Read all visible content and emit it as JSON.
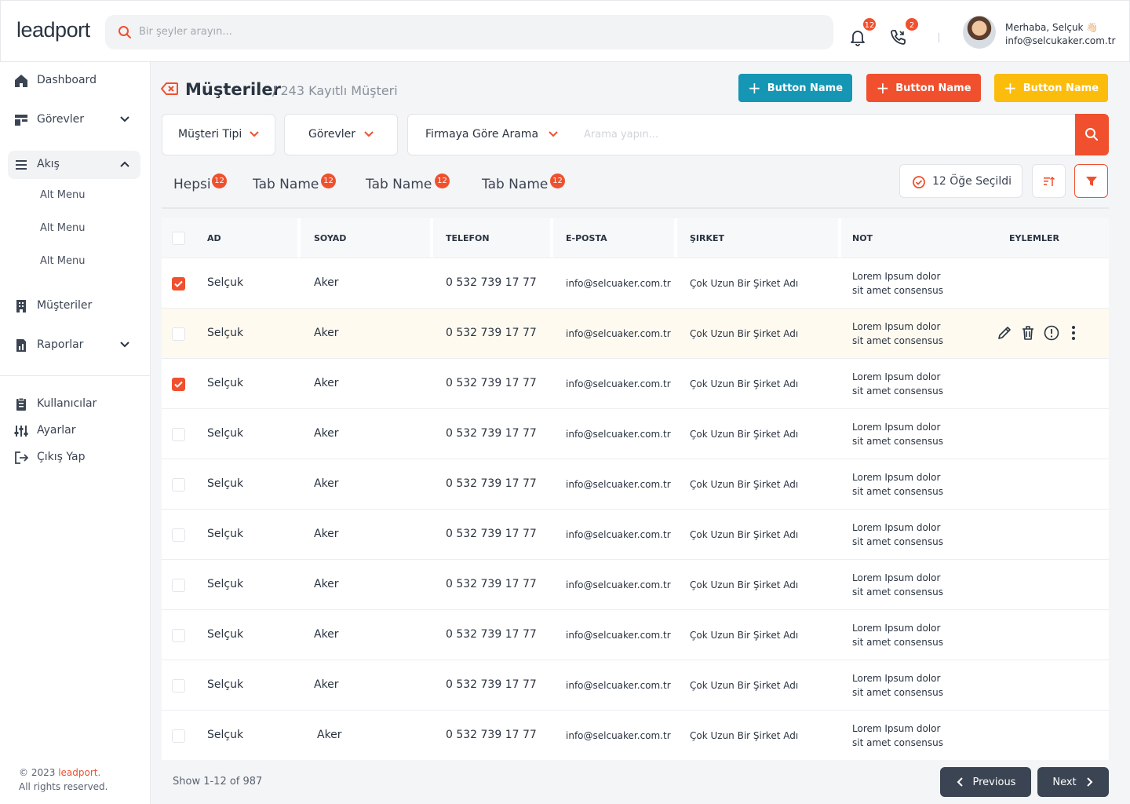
{
  "brand": {
    "logo": "leadport"
  },
  "search": {
    "placeholder": "Bir şeyler arayın..."
  },
  "notifications": {
    "bell_count": "12",
    "call_count": "2"
  },
  "user": {
    "greeting": "Merhaba, Selçuk 👋🏻",
    "email": "info@selcukaker.com.tr"
  },
  "sidebar": {
    "items": [
      {
        "label": "Dashboard",
        "icon": "home-icon"
      },
      {
        "label": "Görevler",
        "icon": "board-icon"
      },
      {
        "label": "Akış",
        "icon": "list-icon"
      },
      {
        "label": "Müşteriler",
        "icon": "building-icon"
      },
      {
        "label": "Raporlar",
        "icon": "report-icon"
      }
    ],
    "sub_items": [
      "Alt Menu",
      "Alt Menu",
      "Alt Menu"
    ],
    "bottom": [
      {
        "label": "Kullanıcılar",
        "icon": "clipboard-icon"
      },
      {
        "label": "Ayarlar",
        "icon": "sliders-icon"
      },
      {
        "label": "Çıkış Yap",
        "icon": "logout-icon"
      }
    ],
    "footer": {
      "year": "© 2023",
      "brand": "leadport",
      "dot": ".",
      "rights": "All rights reserved."
    }
  },
  "page": {
    "title": "Müşteriler",
    "subtitle": "/ 243 Kayıtlı Müşteri"
  },
  "buttons": [
    {
      "label": "Button Name",
      "color": "#1496b4"
    },
    {
      "label": "Button Name",
      "color": "#f0502d"
    },
    {
      "label": "Button Name",
      "color": "#fbbc0c"
    }
  ],
  "filters": {
    "customer_type": "Müşteri Tipi",
    "tasks": "Görevler",
    "company_search": "Firmaya Göre Arama",
    "search_placeholder": "Arama yapın..."
  },
  "tabs": [
    {
      "label": "Hepsi",
      "count": "12"
    },
    {
      "label": "Tab Name",
      "count": "12"
    },
    {
      "label": "Tab Name",
      "count": "12"
    },
    {
      "label": "Tab Name",
      "count": "12"
    }
  ],
  "selection": {
    "label": "12 Öğe Seçildi"
  },
  "table": {
    "columns": [
      "AD",
      "SOYAD",
      "TELEFON",
      "E-POSTA",
      "ŞIRKET",
      "NOT",
      "EYLEMLER"
    ],
    "rows": [
      {
        "checked": true,
        "ad": "Selçuk",
        "soyad": "Aker",
        "telefon": "0 532 739 17 77",
        "eposta": "info@selcuaker.com.tr",
        "sirket": "Çok Uzun Bir Şirket Adı",
        "not1": "Lorem Ipsum dolor",
        "not2": "sit amet consensus"
      },
      {
        "checked": false,
        "highlight": true,
        "ad": "Selçuk",
        "soyad": "Aker",
        "telefon": "0 532 739 17 77",
        "eposta": "info@selcuaker.com.tr",
        "sirket": "Çok Uzun Bir Şirket Adı",
        "not1": "Lorem Ipsum dolor",
        "not2": "sit amet consensus"
      },
      {
        "checked": true,
        "ad": "Selçuk",
        "soyad": "Aker",
        "telefon": "0 532 739 17 77",
        "eposta": "info@selcuaker.com.tr",
        "sirket": "Çok Uzun Bir Şirket Adı",
        "not1": "Lorem Ipsum dolor",
        "not2": "sit amet consensus"
      },
      {
        "checked": false,
        "ad": "Selçuk",
        "soyad": "Aker",
        "telefon": "0 532 739 17 77",
        "eposta": "info@selcuaker.com.tr",
        "sirket": "Çok Uzun Bir Şirket Adı",
        "not1": "Lorem Ipsum dolor",
        "not2": "sit amet consensus"
      },
      {
        "checked": false,
        "ad": "Selçuk",
        "soyad": "Aker",
        "telefon": "0 532 739 17 77",
        "eposta": "info@selcuaker.com.tr",
        "sirket": "Çok Uzun Bir Şirket Adı",
        "not1": "Lorem Ipsum dolor",
        "not2": "sit amet consensus"
      },
      {
        "checked": false,
        "ad": "Selçuk",
        "soyad": "Aker",
        "telefon": "0 532 739 17 77",
        "eposta": "info@selcuaker.com.tr",
        "sirket": "Çok Uzun Bir Şirket Adı",
        "not1": "Lorem Ipsum dolor",
        "not2": "sit amet consensus"
      },
      {
        "checked": false,
        "ad": "Selçuk",
        "soyad": "Aker",
        "telefon": "0 532 739 17 77",
        "eposta": "info@selcuaker.com.tr",
        "sirket": "Çok Uzun Bir Şirket Adı",
        "not1": "Lorem Ipsum dolor",
        "not2": "sit amet consensus"
      },
      {
        "checked": false,
        "ad": "Selçuk",
        "soyad": "Aker",
        "telefon": "0 532 739 17 77",
        "eposta": "info@selcuaker.com.tr",
        "sirket": "Çok Uzun Bir Şirket Adı",
        "not1": "Lorem Ipsum dolor",
        "not2": "sit amet consensus"
      },
      {
        "checked": false,
        "ad": "Selçuk",
        "soyad": "Aker",
        "telefon": "0 532 739 17 77",
        "eposta": "info@selcuaker.com.tr",
        "sirket": "Çok Uzun Bir Şirket Adı",
        "not1": "Lorem Ipsum dolor",
        "not2": "sit amet consensus"
      },
      {
        "checked": false,
        "ad": "Selçuk",
        "soyad": "Aker",
        "telefon": "0 532 739 17 77",
        "eposta": "info@selcuaker.com.tr",
        "sirket": "Çok Uzun Bir Şirket Adı",
        "not1": "Lorem Ipsum dolor",
        "not2": "sit amet consensus"
      }
    ]
  },
  "pagination": {
    "show": "Show 1-12 of 987",
    "previous": "Previous",
    "next": "Next"
  }
}
